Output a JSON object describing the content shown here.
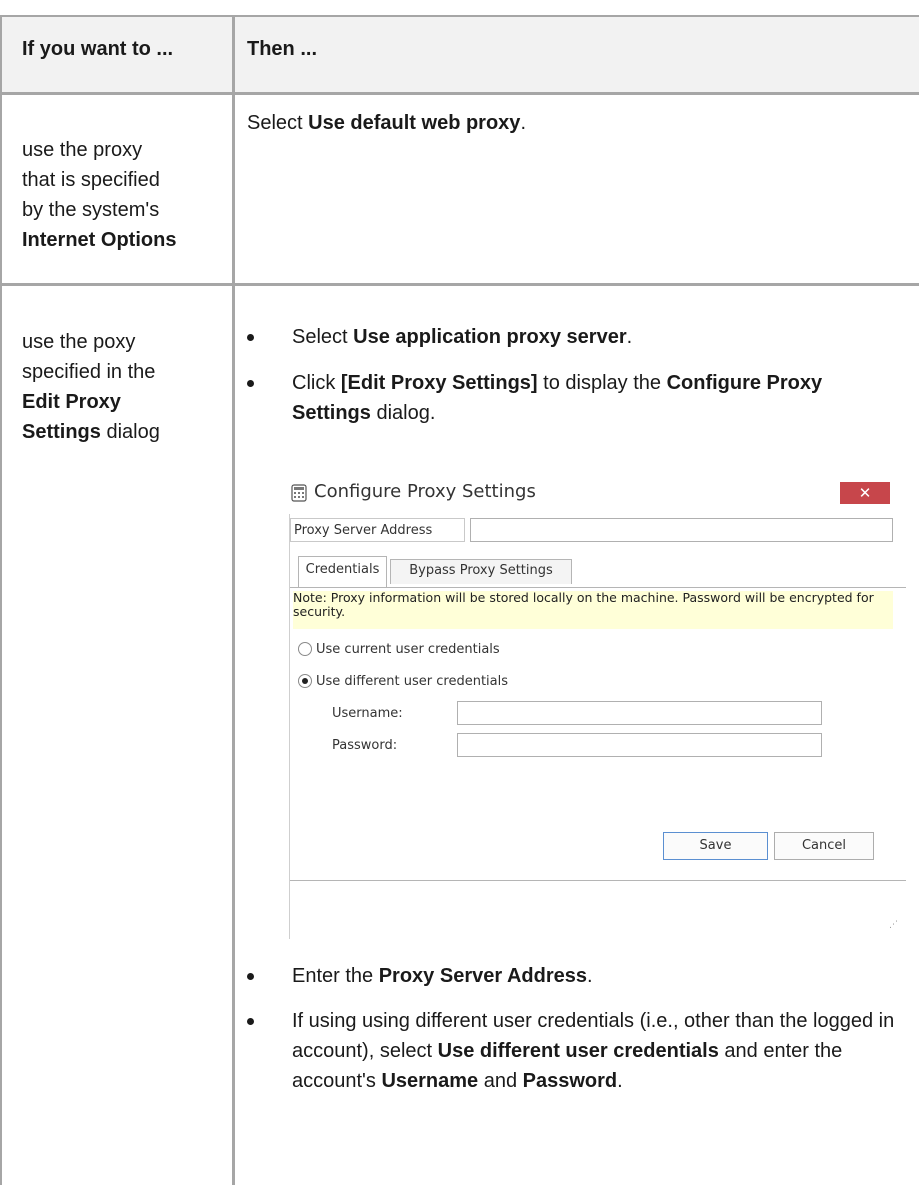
{
  "table": {
    "header": {
      "col1": "If you want to ...",
      "col2": "Then ..."
    },
    "row1": {
      "condition_lines": [
        "use the proxy",
        "that is specified",
        "by the system's"
      ],
      "condition_bold": "Internet Options",
      "action_prefix": "Select ",
      "action_bold": "Use default web proxy",
      "action_suffix": "."
    },
    "row2": {
      "condition_lines": [
        "use the poxy",
        "specified in the"
      ],
      "condition_bold_1": "Edit Proxy",
      "condition_bold_2": "Settings",
      "condition_suffix": " dialog",
      "bullets": {
        "b1_prefix": "Select ",
        "b1_bold": "Use application proxy server",
        "b1_suffix": ".",
        "b2_prefix": "Click ",
        "b2_bold": "[Edit Proxy Settings]",
        "b2_mid": " to display the ",
        "b2_bold2": "Configure Proxy Settings",
        "b2_suffix": " dialog.",
        "b3_prefix": "Enter the ",
        "b3_bold": "Proxy Server Address",
        "b3_suffix": ".",
        "b4_text": "If using using different user credentials (i.e., other than the logged in account), select ",
        "b4_bold": "Use different user credentials",
        "b4_mid": " and enter the account's  ",
        "b4_bold2": "Username",
        "b4_mid2": " and ",
        "b4_bold3": "Password",
        "b4_suffix": "."
      }
    }
  },
  "dialog": {
    "title": "Configure Proxy Settings",
    "close_glyph": "✕",
    "close_color": "#c7464b",
    "proxy_address_label": "Proxy Server Address",
    "proxy_address_value": "",
    "tabs": [
      "Credentials",
      "Bypass Proxy Settings"
    ],
    "active_tab": "Credentials",
    "note": "Note: Proxy information will be stored locally on the machine.  Password will be encrypted for security.",
    "radio_current": "Use current user credentials",
    "radio_different": "Use different user credentials",
    "selected_radio": "Use different user credentials",
    "username_label": "Username:",
    "password_label": "Password:",
    "save_label": "Save",
    "cancel_label": "Cancel"
  }
}
